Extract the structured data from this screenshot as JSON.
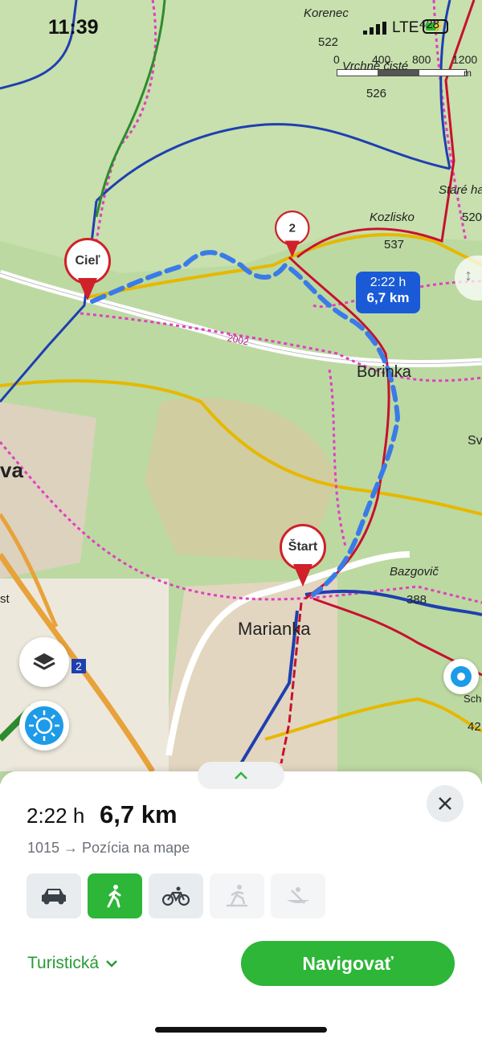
{
  "status_bar": {
    "time": "11:39",
    "network": "LTE"
  },
  "map": {
    "scale_labels": [
      "0",
      "400",
      "800",
      "1200"
    ],
    "scale_unit": "m",
    "place_labels": {
      "korenec": "Korenec",
      "korenec_elev": "522",
      "vrchne_ciste": "Vrchné čisté",
      "vrchne_elev": "526",
      "top_elev": "428",
      "stare_hory": "Staré ha",
      "stare_elev": "520",
      "kozlisko": "Kozlisko",
      "kozlisko_elev": "537",
      "borinka": "Borinka",
      "road_2002": "2002",
      "marianka": "Marianka",
      "bazgovic": "Bazgovič",
      "bazgovic_elev": "388",
      "sv": "Sv",
      "va": "va",
      "st": "st",
      "road_2": "2",
      "sch": "Sch",
      "sch_elev": "42"
    },
    "pins": {
      "destination": "Cieľ",
      "waypoint": "2",
      "start": "Štart"
    },
    "route_tag": {
      "duration": "2:22 h",
      "distance": "6,7 km"
    }
  },
  "colors": {
    "route": "#2f6fe0",
    "trail_red": "#c8102e",
    "trail_blue": "#1f3fb0",
    "trail_yellow": "#e6b800",
    "trail_green": "#2e8b2e",
    "accent_green": "#2db637"
  },
  "sheet": {
    "duration": "2:22 h",
    "distance": "6,7 km",
    "route_text": "1015 → Pozícia na mape",
    "modes": [
      {
        "name": "car",
        "icon": "car-icon",
        "active": false,
        "enabled": true
      },
      {
        "name": "walk",
        "icon": "walk-icon",
        "active": true,
        "enabled": true
      },
      {
        "name": "bike",
        "icon": "bike-icon",
        "active": false,
        "enabled": true
      },
      {
        "name": "ski",
        "icon": "ski-icon",
        "active": false,
        "enabled": false
      },
      {
        "name": "canoe",
        "icon": "canoe-icon",
        "active": false,
        "enabled": false
      }
    ],
    "profile_label": "Turistická",
    "navigate_label": "Navigovať"
  }
}
